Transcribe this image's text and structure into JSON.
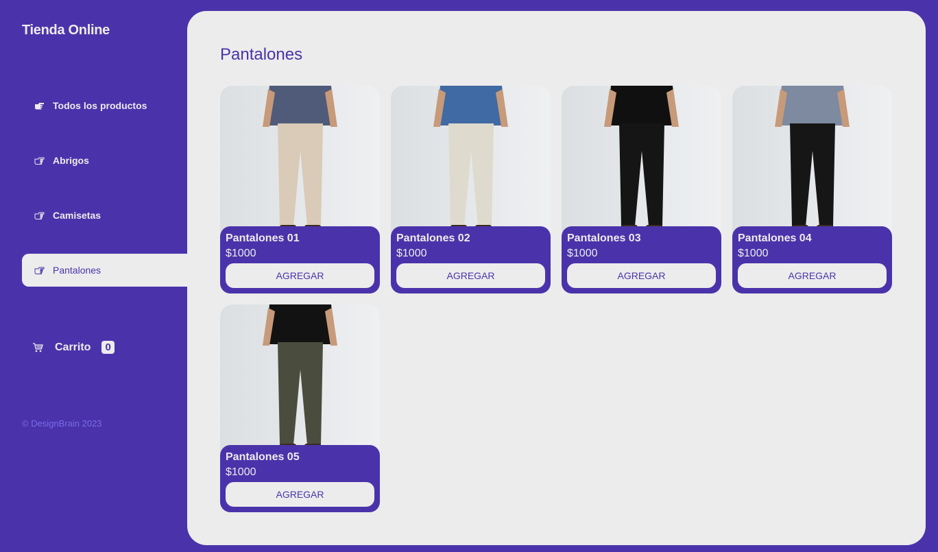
{
  "brand": "Tienda Online",
  "menu": [
    {
      "label": "Todos los productos",
      "icon": "pointing-hand-filled-icon",
      "active": false
    },
    {
      "label": "Abrigos",
      "icon": "pointing-hand-icon",
      "active": false
    },
    {
      "label": "Camisetas",
      "icon": "pointing-hand-icon",
      "active": false
    },
    {
      "label": "Pantalones",
      "icon": "pointing-hand-icon",
      "active": true
    }
  ],
  "cart": {
    "label": "Carrito",
    "count": "0",
    "icon": "cart-icon"
  },
  "footer": "© DesignBrain 2023",
  "page_title": "Pantalones",
  "products": [
    {
      "name": "Pantalones 01",
      "price": "$1000",
      "button": "AGREGAR",
      "pants_color": "#d9cbb7",
      "shirt_color": "#4f5b78"
    },
    {
      "name": "Pantalones 02",
      "price": "$1000",
      "button": "AGREGAR",
      "pants_color": "#dedacd",
      "shirt_color": "#3f6aa3"
    },
    {
      "name": "Pantalones 03",
      "price": "$1000",
      "button": "AGREGAR",
      "pants_color": "#151515",
      "shirt_color": "#101010"
    },
    {
      "name": "Pantalones 04",
      "price": "$1000",
      "button": "AGREGAR",
      "pants_color": "#161616",
      "shirt_color": "#7d8aa0"
    },
    {
      "name": "Pantalones 05",
      "price": "$1000",
      "button": "AGREGAR",
      "pants_color": "#4a4d3d",
      "shirt_color": "#121212"
    }
  ],
  "colors": {
    "accent": "#4a33aa",
    "background": "#ececec",
    "footer_text": "#7a6ae8"
  }
}
